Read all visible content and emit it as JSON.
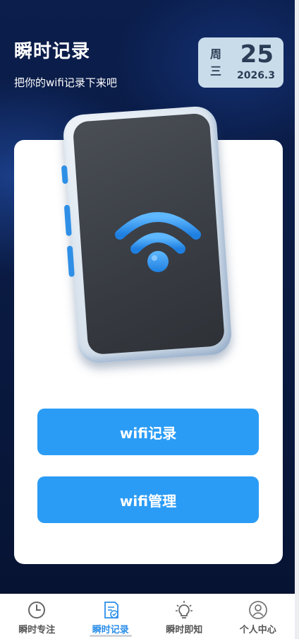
{
  "header": {
    "title": "瞬时记录",
    "subtitle": "把你的wifi记录下来吧"
  },
  "date_card": {
    "weekday_prefix": "周",
    "weekday": "三",
    "day": "25",
    "year_month": "2026.3"
  },
  "actions": {
    "record_label": "wifi记录",
    "manage_label": "wifi管理"
  },
  "tabs": [
    {
      "label": "瞬时专注",
      "icon": "clock-icon",
      "active": false
    },
    {
      "label": "瞬时记录",
      "icon": "note-check-icon",
      "active": true
    },
    {
      "label": "瞬时即知",
      "icon": "lightbulb-icon",
      "active": false
    },
    {
      "label": "个人中心",
      "icon": "user-icon",
      "active": false
    }
  ],
  "colors": {
    "accent": "#2b9cf5",
    "active_tab": "#2b8ee8",
    "background": "#0a1b44",
    "date_card": "#c9dcea"
  }
}
